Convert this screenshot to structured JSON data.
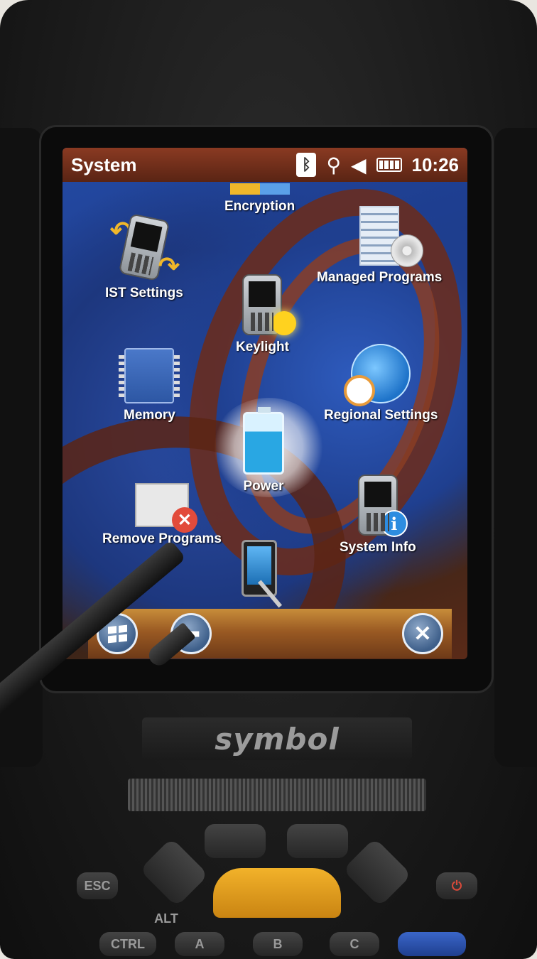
{
  "status_bar": {
    "title": "System",
    "time": "10:26",
    "icons": [
      "bluetooth-icon",
      "connectivity-icon",
      "speaker-muted-icon",
      "battery-icon"
    ]
  },
  "apps": [
    {
      "label": "Encryption",
      "icon": "encryption-icon"
    },
    {
      "label": "IST Settings",
      "icon": "ist-settings-icon"
    },
    {
      "label": "Keylight",
      "icon": "keylight-icon"
    },
    {
      "label": "Managed Programs",
      "icon": "managed-programs-icon"
    },
    {
      "label": "Memory",
      "icon": "memory-icon"
    },
    {
      "label": "Regional Settings",
      "icon": "regional-settings-icon"
    },
    {
      "label": "Power",
      "icon": "power-icon"
    },
    {
      "label": "Remove Programs",
      "icon": "remove-programs-icon"
    },
    {
      "label": "System Info",
      "icon": "system-info-icon"
    }
  ],
  "softbar": {
    "start": "windows-start-icon",
    "back": "back-arrow-icon",
    "close": "close-icon"
  },
  "device": {
    "brand": "symbol",
    "keys": {
      "esc": "ESC",
      "ctrl": "CTRL",
      "alt": "ALT",
      "a": "A",
      "b": "B",
      "c": "C"
    }
  },
  "colors": {
    "status_bar": "#6e2c18",
    "softbar": "#9a5a23",
    "wallpaper_blue": "#1f3f8f",
    "brand_key": "#f2b22a"
  }
}
